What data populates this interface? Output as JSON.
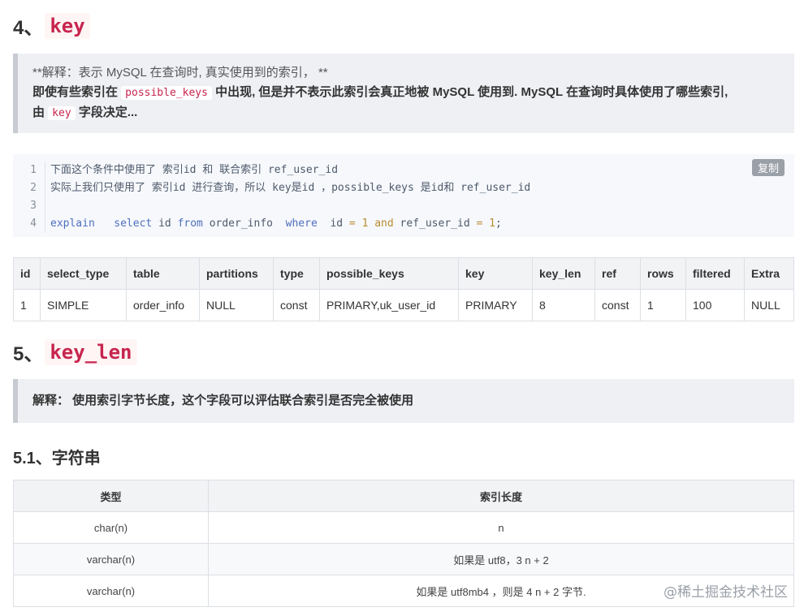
{
  "section4": {
    "number": "4、",
    "code": "key"
  },
  "quote4": {
    "line1": "**解释：表示 MySQL 在查询时, 真实使用到的索引， **",
    "line2_a": "即使有些索引在 ",
    "line2_code": "possible_keys",
    "line2_b": " 中出现, 但是并不表示此索引会真正地被 MySQL 使用到. MySQL 在查询时具体使用了哪些索引,",
    "line3_a": "由 ",
    "line3_code": "key",
    "line3_b": " 字段决定..."
  },
  "code": {
    "copy_label": "复制",
    "line_numbers": [
      "1",
      "2",
      "3",
      "4"
    ],
    "line1": "下面这个条件中使用了 索引id 和 联合索引 ref_user_id",
    "line2": "实际上我们只使用了 索引id 进行查询，所以 key是id ，possible_keys 是id和 ref_user_id",
    "line4_tokens": [
      "explain",
      "select",
      "id",
      "from",
      "order_info",
      "where",
      "id",
      "=",
      "1",
      "and",
      "ref_user_id",
      "=",
      "1",
      ";"
    ]
  },
  "explain_table": {
    "headers": [
      "id",
      "select_type",
      "table",
      "partitions",
      "type",
      "possible_keys",
      "key",
      "key_len",
      "ref",
      "rows",
      "filtered",
      "Extra"
    ],
    "row": [
      "1",
      "SIMPLE",
      "order_info",
      "NULL",
      "const",
      "PRIMARY,uk_user_id",
      "PRIMARY",
      "8",
      "const",
      "1",
      "100",
      "NULL"
    ]
  },
  "section5": {
    "number": "5、",
    "code": "key_len"
  },
  "quote5": {
    "text": "解释： 使用索引字节长度，这个字段可以评估联合索引是否完全被使用"
  },
  "section51": {
    "title": "5.1、字符串"
  },
  "string_table": {
    "headers": [
      "类型",
      "索引长度"
    ],
    "rows": [
      [
        "char(n)",
        "n"
      ],
      [
        "varchar(n)",
        "如果是 utf8，3 n + 2"
      ],
      [
        "varchar(n)",
        "如果是 utf8mb4 ，则是 4 n + 2 字节."
      ]
    ]
  },
  "watermark": "@稀土掘金技术社区"
}
